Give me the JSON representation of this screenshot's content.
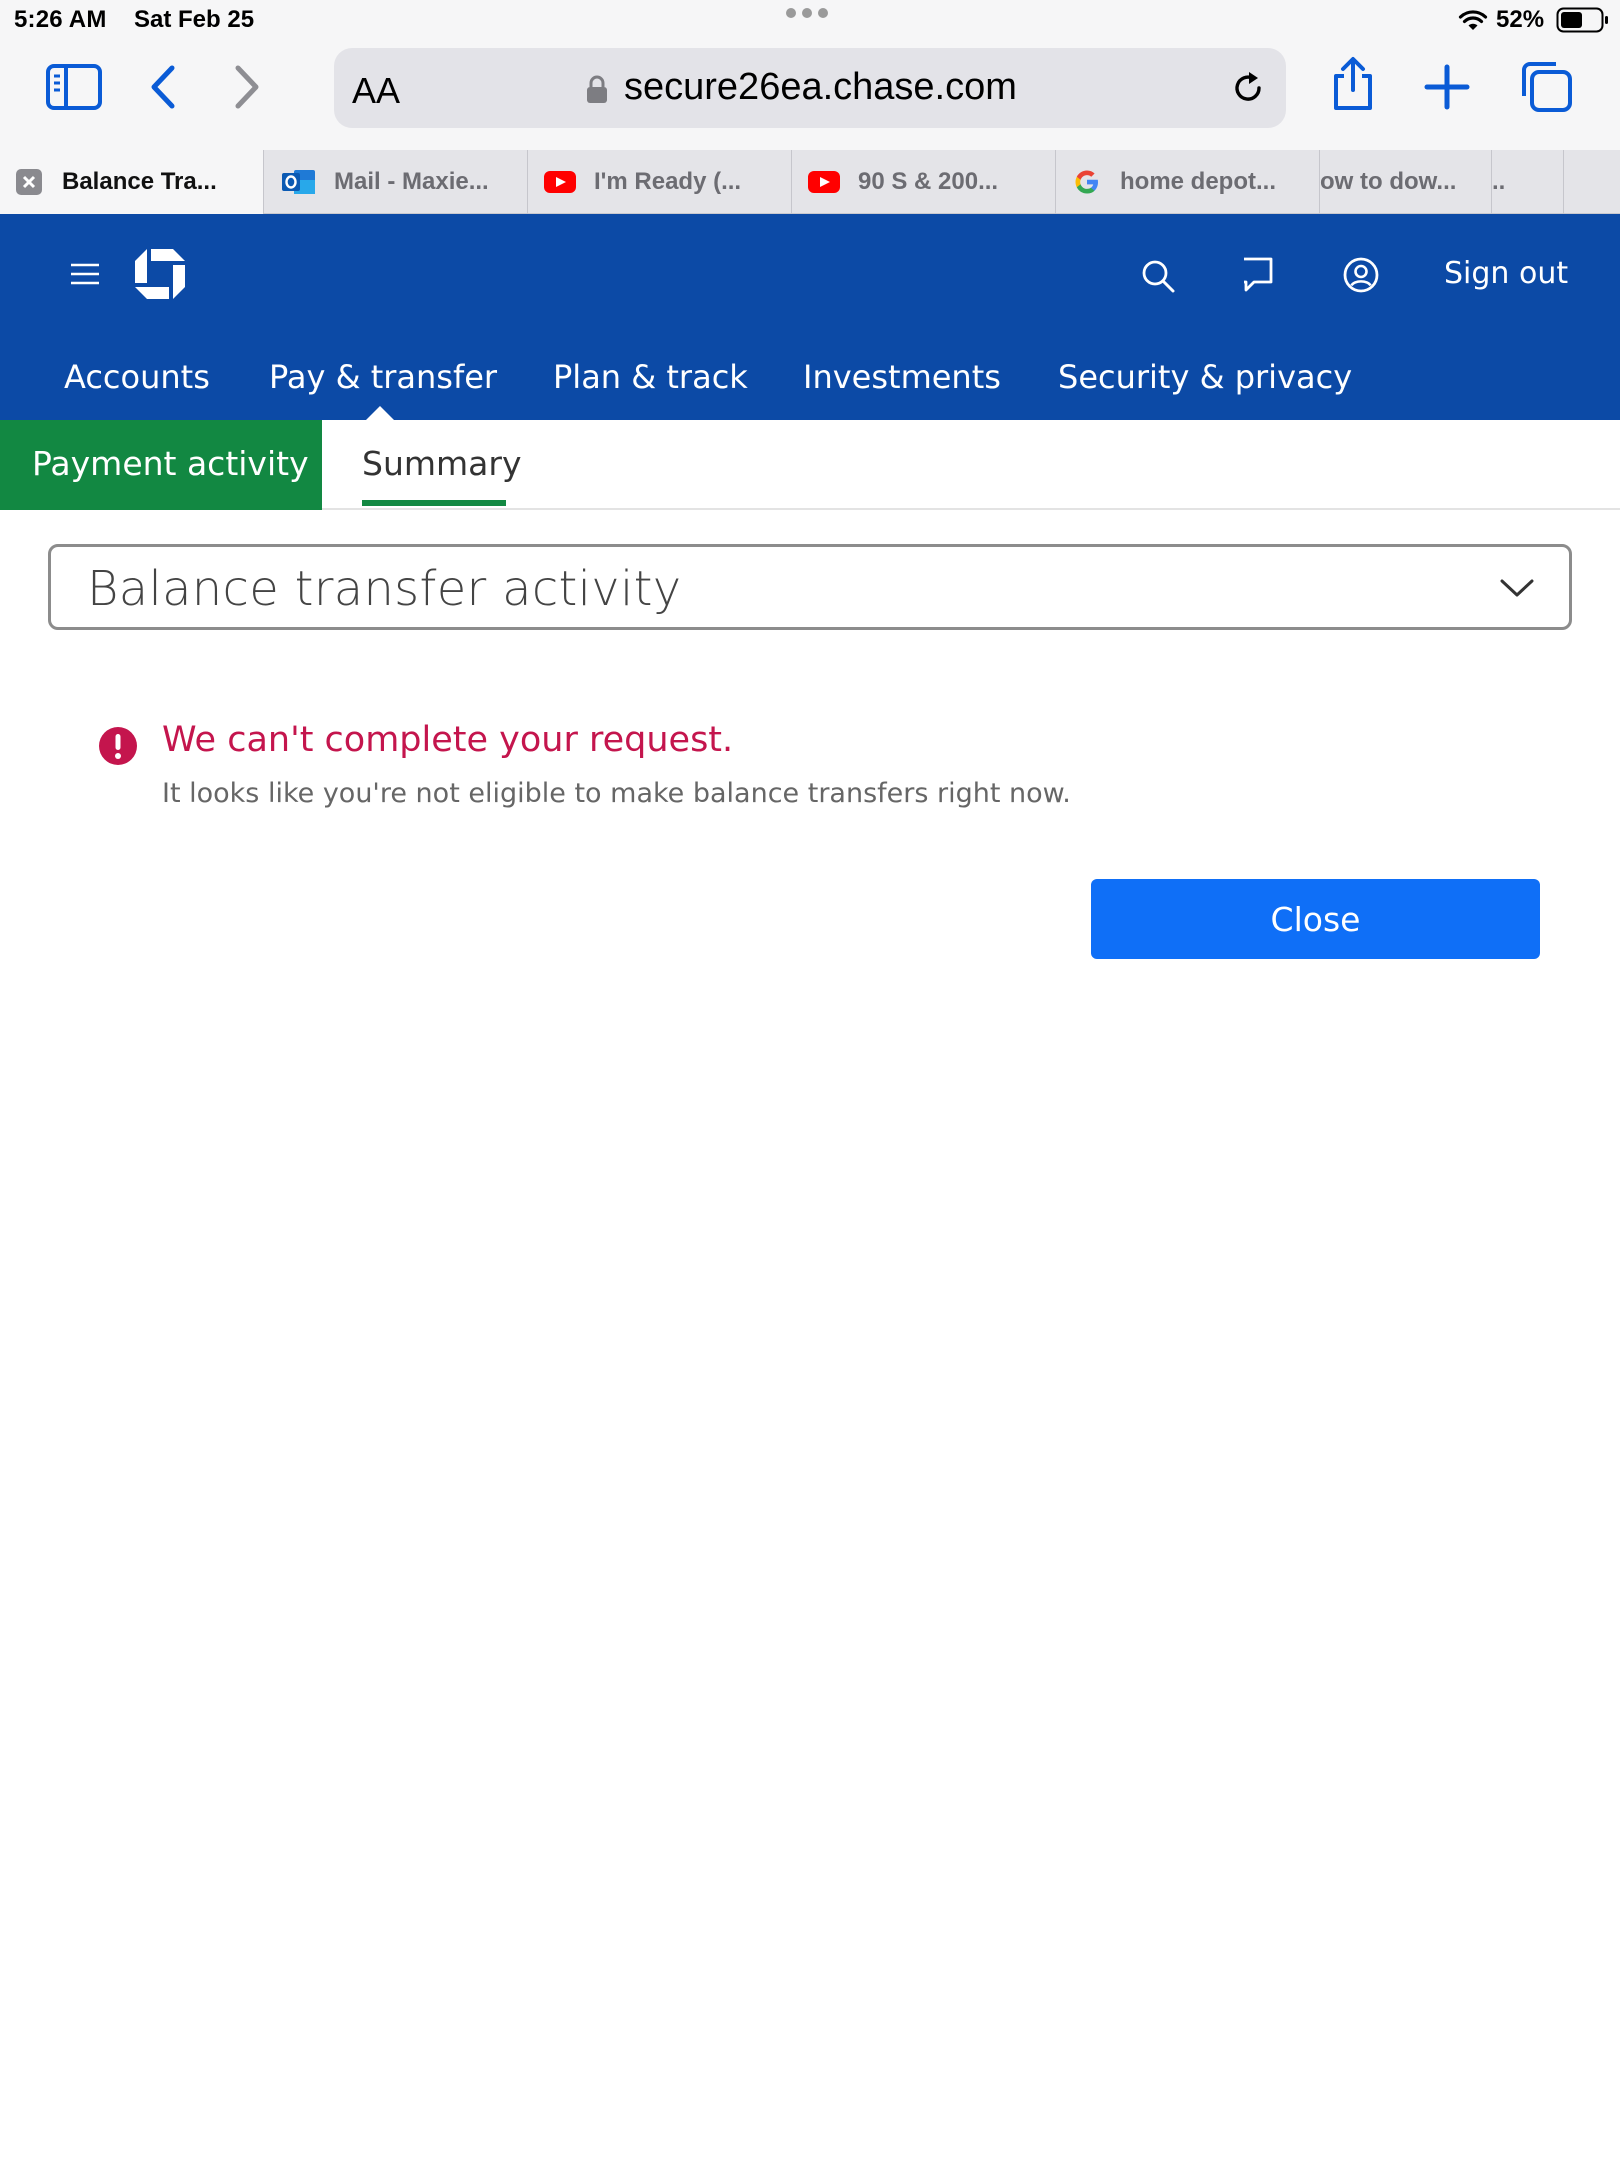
{
  "status_bar": {
    "time": "5:26 AM",
    "date": "Sat Feb 25",
    "battery": "52%"
  },
  "browser": {
    "text_size_label": "AA",
    "url": "secure26ea.chase.com",
    "icons": [
      "sidebar-icon",
      "back-icon",
      "forward-icon",
      "lock-icon",
      "reload-icon",
      "share-icon",
      "new-tab-icon",
      "tabs-icon"
    ]
  },
  "tabs": [
    {
      "label": "Balance Tra...",
      "icon": "close-tab-icon",
      "active": true
    },
    {
      "label": "Mail - Maxie...",
      "icon": "outlook-icon",
      "active": false
    },
    {
      "label": "I'm Ready (...",
      "icon": "youtube-icon",
      "active": false
    },
    {
      "label": "90 S & 200...",
      "icon": "youtube-icon",
      "active": false
    },
    {
      "label": "home depot...",
      "icon": "google-icon",
      "active": false
    },
    {
      "label": "ow to dow...",
      "icon": "",
      "active": false
    },
    {
      "label": "..",
      "icon": "",
      "active": false
    }
  ],
  "header": {
    "sign_out": "Sign out",
    "nav": [
      "Accounts",
      "Pay & transfer",
      "Plan & track",
      "Investments",
      "Security & privacy"
    ],
    "active_nav": "Pay & transfer"
  },
  "subtabs": {
    "payment_activity": "Payment activity",
    "summary": "Summary"
  },
  "dropdown": {
    "value": "Balance transfer activity"
  },
  "error": {
    "title": "We can't complete your request.",
    "message": "It looks like you're not eligible to make balance transfers right now."
  },
  "close_button": "Close",
  "colors": {
    "chase_blue": "#0c4aa6",
    "active_green": "#128842",
    "error_red": "#c4154d",
    "button_blue": "#0f6ff7",
    "safari_blue": "#0a5bd6"
  }
}
